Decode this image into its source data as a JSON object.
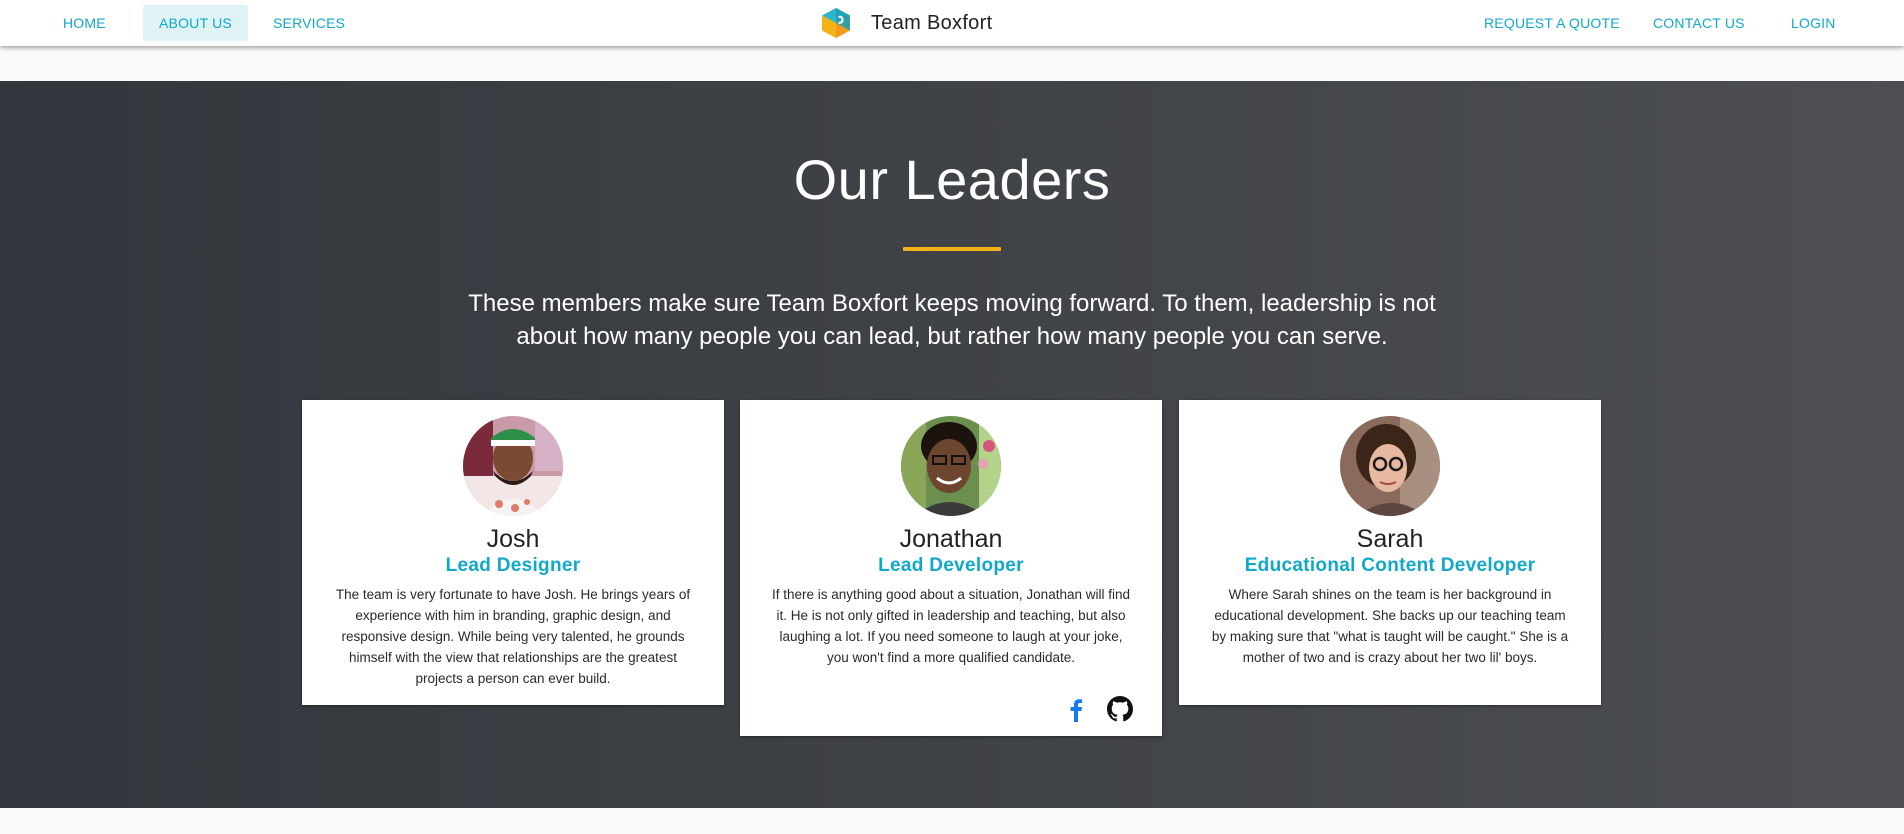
{
  "nav": {
    "left": [
      {
        "label": "HOME"
      },
      {
        "label": "ABOUT US"
      },
      {
        "label": "SERVICES"
      }
    ],
    "brand": {
      "title": "Team Boxfort",
      "icon": "boxfort-logo-icon"
    },
    "right": [
      {
        "label": "REQUEST A QUOTE"
      },
      {
        "label": "CONTACT US"
      },
      {
        "label": "LOGIN"
      }
    ],
    "active": "ABOUT US"
  },
  "hero": {
    "title": "Our Leaders",
    "lead": "These members make sure Team Boxfort keeps moving forward. To them, leadership is not about how many people you can lead, but rather how many people you can serve."
  },
  "leaders": [
    {
      "name": "Josh",
      "role": "Lead Designer",
      "bio": "The team is very fortunate to have Josh. He brings years of experience with him in branding, graphic design, and responsive design. While being very talented, he grounds himself with the view that relationships are the greatest projects a person can ever build."
    },
    {
      "name": "Jonathan",
      "role": "Lead Developer",
      "bio": "If there is anything good about a situation, Jonathan will find it. He is not only gifted in leadership and teaching, but also laughing a lot. If you need someone to laugh at your joke, you won't find a more qualified candidate.",
      "social": [
        "facebook-icon",
        "github-icon"
      ]
    },
    {
      "name": "Sarah",
      "role": "Educational Content Developer",
      "bio": "Where Sarah shines on the team is her background in educational development. She backs up our teaching team by making sure that \"what is taught will be caught.\" She is a mother of two and is crazy about her two lil' boys."
    }
  ],
  "colors": {
    "accent": "#11a9c8",
    "rule": "#f3b316",
    "facebook": "#1877f2",
    "hero_bg": "#3f4246"
  }
}
